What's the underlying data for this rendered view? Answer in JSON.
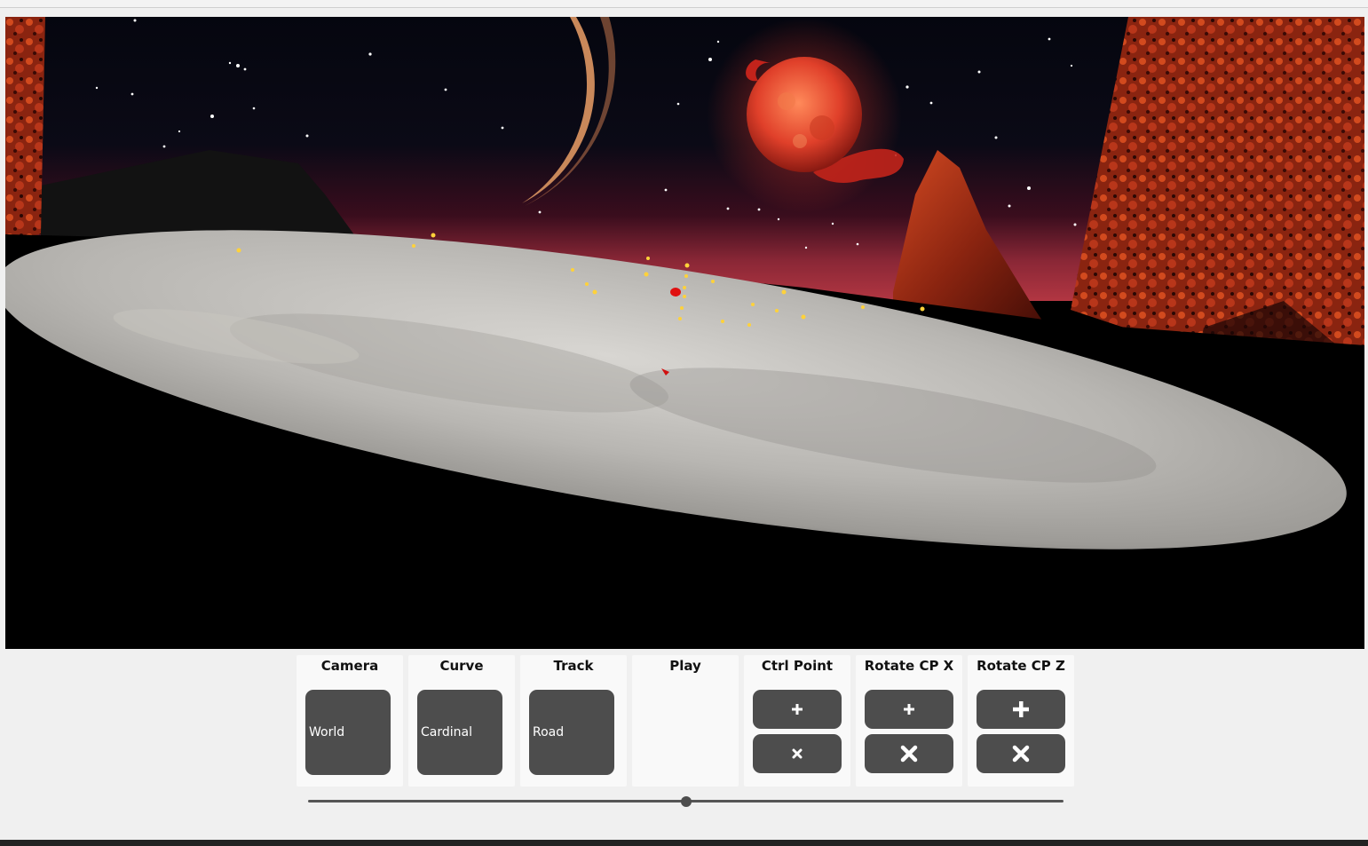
{
  "controls": {
    "camera": {
      "title": "Camera",
      "value": "World"
    },
    "curve": {
      "title": "Curve",
      "value": "Cardinal"
    },
    "track": {
      "title": "Track",
      "value": "Road"
    },
    "play": {
      "title": "Play"
    },
    "ctrl_point": {
      "title": "Ctrl Point",
      "add_icon": "plus-icon",
      "remove_icon": "times-icon"
    },
    "rotate_cp_x": {
      "title": "Rotate CP X",
      "add_icon": "plus-icon",
      "remove_icon": "times-icon"
    },
    "rotate_cp_z": {
      "title": "Rotate CP Z",
      "add_icon": "plus-icon",
      "remove_icon": "times-icon"
    }
  },
  "timeline": {
    "value_fraction": 0.5
  },
  "colors": {
    "button": "#4d4d4d",
    "panel": "#f9f9f9",
    "page": "#f0f0f0",
    "planet": "#e2462a",
    "rock": "#b8361a"
  }
}
